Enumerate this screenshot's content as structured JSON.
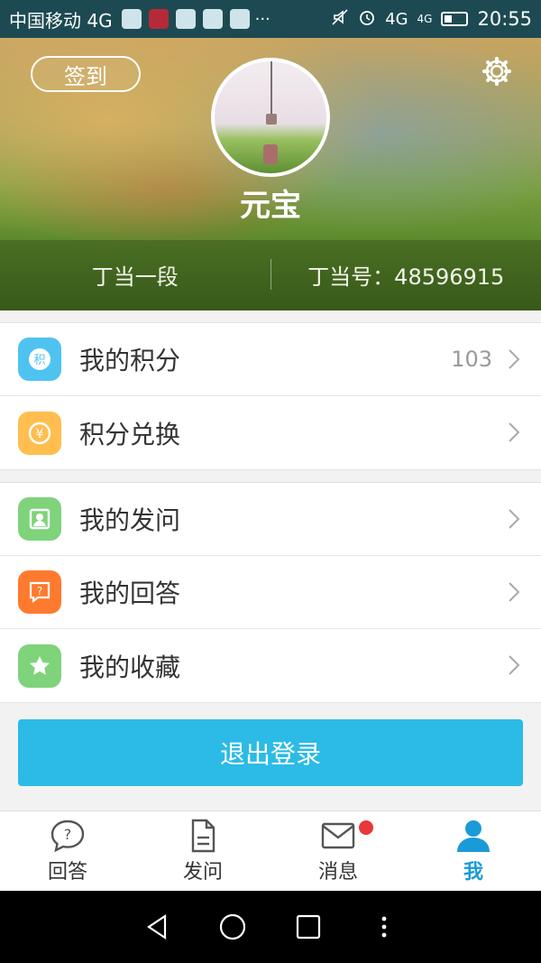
{
  "status_bar": {
    "carrier": "中国移动 4G",
    "more": "···",
    "network_1": "4G",
    "network_2": "4G",
    "time": "20:55"
  },
  "header": {
    "signin_label": "签到",
    "username": "元宝",
    "level": "丁当一段",
    "id_label": "丁当号：48596915"
  },
  "menu_group_1": [
    {
      "label": "我的积分",
      "value": "103",
      "icon": "points-icon",
      "color": "#4fc3f0",
      "glyph": "积"
    },
    {
      "label": "积分兑换",
      "value": "",
      "icon": "exchange-icon",
      "color": "#ffbe4f",
      "glyph": "¥"
    }
  ],
  "menu_group_2": [
    {
      "label": "我的发问",
      "icon": "portrait-icon",
      "color": "#7fd37a"
    },
    {
      "label": "我的回答",
      "icon": "answer-icon",
      "color": "#ff7a2f"
    },
    {
      "label": "我的收藏",
      "icon": "star-icon",
      "color": "#7fd37a"
    }
  ],
  "logout_label": "退出登录",
  "tabs": [
    {
      "label": "回答",
      "icon": "question-bubble-icon"
    },
    {
      "label": "发问",
      "icon": "document-icon"
    },
    {
      "label": "消息",
      "icon": "envelope-icon"
    },
    {
      "label": "我",
      "icon": "person-icon",
      "active": true
    }
  ],
  "colors": {
    "accent": "#2bbbe6",
    "tab_active": "#1a9bd7",
    "badge": "#e8383d"
  }
}
